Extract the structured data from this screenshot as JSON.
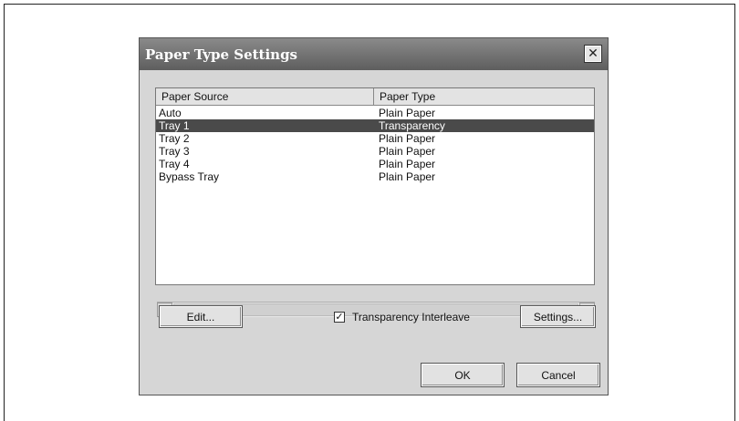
{
  "dialog": {
    "title": "Paper Type Settings",
    "close_icon": "close-icon"
  },
  "list": {
    "columns": [
      "Paper Source",
      "Paper Type"
    ],
    "rows": [
      {
        "source": "Auto",
        "type": "Plain Paper",
        "selected": false
      },
      {
        "source": "Tray 1",
        "type": "Transparency",
        "selected": true
      },
      {
        "source": "Tray 2",
        "type": "Plain Paper",
        "selected": false
      },
      {
        "source": "Tray 3",
        "type": "Plain Paper",
        "selected": false
      },
      {
        "source": "Tray 4",
        "type": "Plain Paper",
        "selected": false
      },
      {
        "source": "Bypass Tray",
        "type": "Plain Paper",
        "selected": false
      }
    ],
    "scroll_left_icon": "arrow-left-icon",
    "scroll_right_icon": "arrow-right-icon"
  },
  "controls": {
    "edit_label": "Edit...",
    "transparency_interleave_label": "Transparency Interleave",
    "transparency_interleave_checked": true,
    "settings_label": "Settings...",
    "ok_label": "OK",
    "cancel_label": "Cancel"
  }
}
